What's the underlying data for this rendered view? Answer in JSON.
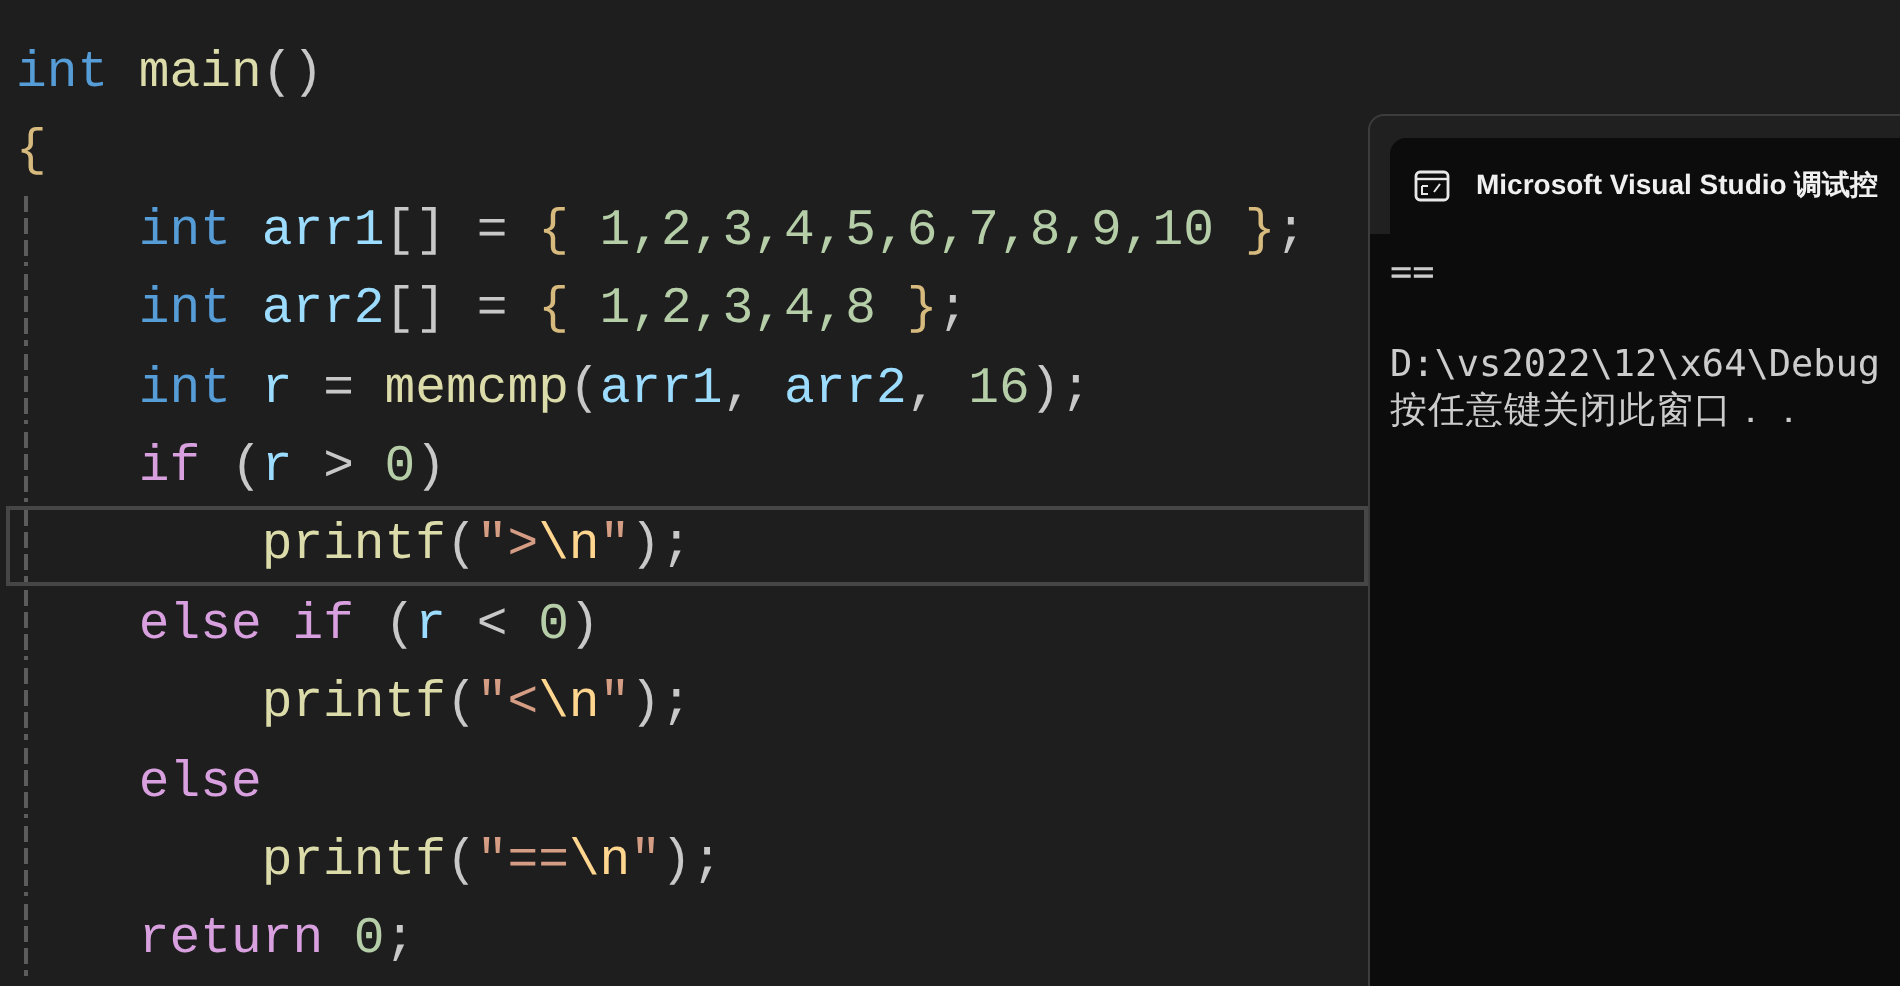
{
  "editor": {
    "lines": [
      {
        "current": false,
        "tokens": [
          {
            "kind": "keyword",
            "text": "int"
          },
          {
            "kind": "function",
            "text": " main"
          },
          {
            "kind": "punct",
            "text": "()"
          }
        ]
      },
      {
        "current": false,
        "tokens": [
          {
            "kind": "brace",
            "text": "{"
          }
        ],
        "children": [
          {
            "current": false,
            "tokens": [
              {
                "kind": "keyword",
                "text": "int"
              },
              {
                "kind": "variable",
                "text": " arr1"
              },
              {
                "kind": "punct",
                "text": "[] ="
              },
              {
                "kind": "brace",
                "text": " {"
              },
              {
                "kind": "number",
                "text": " 1,2,3,4,5,6,7,8,9,10"
              },
              {
                "kind": "brace",
                "text": " }"
              },
              {
                "kind": "punct",
                "text": ";"
              }
            ]
          },
          {
            "current": false,
            "tokens": [
              {
                "kind": "keyword",
                "text": "int"
              },
              {
                "kind": "variable",
                "text": " arr2"
              },
              {
                "kind": "punct",
                "text": "[] ="
              },
              {
                "kind": "brace",
                "text": " {"
              },
              {
                "kind": "number",
                "text": " 1,2,3,4,8"
              },
              {
                "kind": "brace",
                "text": " }"
              },
              {
                "kind": "punct",
                "text": ";"
              }
            ]
          },
          {
            "current": false,
            "tokens": [
              {
                "kind": "keyword",
                "text": "int"
              },
              {
                "kind": "variable",
                "text": " r"
              },
              {
                "kind": "punct",
                "text": " ="
              },
              {
                "kind": "function",
                "text": " memcmp"
              },
              {
                "kind": "punct",
                "text": "("
              },
              {
                "kind": "variable",
                "text": "arr1"
              },
              {
                "kind": "punct",
                "text": ","
              },
              {
                "kind": "variable",
                "text": " arr2"
              },
              {
                "kind": "punct",
                "text": ","
              },
              {
                "kind": "number",
                "text": " 16"
              },
              {
                "kind": "punct",
                "text": ");"
              }
            ]
          },
          {
            "current": false,
            "tokens": [
              {
                "kind": "control",
                "text": "if"
              },
              {
                "kind": "punct",
                "text": " ("
              },
              {
                "kind": "variable",
                "text": "r"
              },
              {
                "kind": "punct",
                "text": " >"
              },
              {
                "kind": "number",
                "text": " 0"
              },
              {
                "kind": "punct",
                "text": ")"
              }
            ],
            "children": [
              {
                "current": true,
                "tokens": [
                  {
                    "kind": "function",
                    "text": "printf"
                  },
                  {
                    "kind": "punct",
                    "text": "("
                  },
                  {
                    "kind": "string",
                    "text": "\">"
                  },
                  {
                    "kind": "escape",
                    "text": "\\n"
                  },
                  {
                    "kind": "string",
                    "text": "\""
                  },
                  {
                    "kind": "punct",
                    "text": ");"
                  }
                ]
              }
            ]
          },
          {
            "current": false,
            "tokens": [
              {
                "kind": "control",
                "text": "else if"
              },
              {
                "kind": "punct",
                "text": " ("
              },
              {
                "kind": "variable",
                "text": "r"
              },
              {
                "kind": "punct",
                "text": " <"
              },
              {
                "kind": "number",
                "text": " 0"
              },
              {
                "kind": "punct",
                "text": ")"
              }
            ],
            "children": [
              {
                "current": false,
                "tokens": [
                  {
                    "kind": "function",
                    "text": "printf"
                  },
                  {
                    "kind": "punct",
                    "text": "("
                  },
                  {
                    "kind": "string",
                    "text": "\"<"
                  },
                  {
                    "kind": "escape",
                    "text": "\\n"
                  },
                  {
                    "kind": "string",
                    "text": "\""
                  },
                  {
                    "kind": "punct",
                    "text": ");"
                  }
                ]
              }
            ]
          },
          {
            "current": false,
            "tokens": [
              {
                "kind": "control",
                "text": "else"
              }
            ],
            "children": [
              {
                "current": false,
                "tokens": [
                  {
                    "kind": "function",
                    "text": "printf"
                  },
                  {
                    "kind": "punct",
                    "text": "("
                  },
                  {
                    "kind": "string",
                    "text": "\"=="
                  },
                  {
                    "kind": "escape",
                    "text": "\\n"
                  },
                  {
                    "kind": "string",
                    "text": "\""
                  },
                  {
                    "kind": "punct",
                    "text": ");"
                  }
                ]
              }
            ]
          },
          {
            "current": false,
            "tokens": [
              {
                "kind": "control",
                "text": "return"
              },
              {
                "kind": "number",
                "text": " 0"
              },
              {
                "kind": "punct",
                "text": ";"
              }
            ]
          }
        ]
      }
    ]
  },
  "console": {
    "title": "Microsoft Visual Studio 调试控",
    "output": [
      "=="
    ],
    "footer": [
      "D:\\vs2022\\12\\x64\\Debug",
      "按任意键关闭此窗口．．"
    ]
  }
}
